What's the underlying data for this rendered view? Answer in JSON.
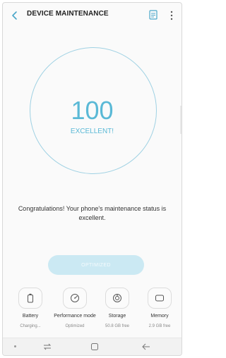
{
  "header": {
    "title": "DEVICE MAINTENANCE"
  },
  "score": {
    "value": "100",
    "label": "EXCELLENT!"
  },
  "message": "Congratulations! Your phone's maintenance status is excellent.",
  "optimize_label": "OPTIMIZED",
  "features": [
    {
      "name": "Battery",
      "status": "Charging...",
      "icon": "battery-icon"
    },
    {
      "name": "Performance mode",
      "status": "Optimized",
      "icon": "speedometer-icon"
    },
    {
      "name": "Storage",
      "status": "50.8 GB free",
      "icon": "storage-icon"
    },
    {
      "name": "Memory",
      "status": "2.9 GB free",
      "icon": "memory-icon"
    }
  ],
  "colors": {
    "accent": "#5ab9d6",
    "ring": "#9fd1e3",
    "button_disabled": "#cbe9f3"
  }
}
